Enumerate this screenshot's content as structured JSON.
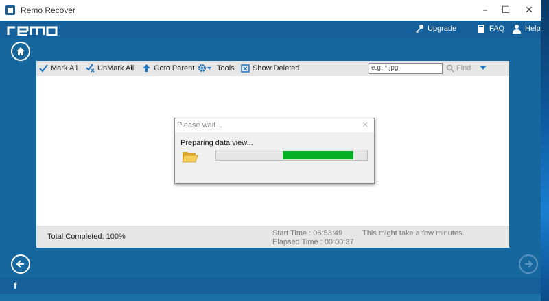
{
  "window": {
    "title": "Remo Recover"
  },
  "brand": {
    "logo_text": "remo"
  },
  "header": {
    "upgrade_label": "Upgrade",
    "faq_label": "FAQ",
    "help_label": "Help"
  },
  "toolbar": {
    "mark_all": "Mark All",
    "unmark_all": "UnMark All",
    "goto_parent": "Goto Parent",
    "tools": "Tools",
    "show_deleted": "Show Deleted",
    "search_placeholder": "e.g. *.jpg",
    "find": "Find"
  },
  "dialog": {
    "title": "Please wait...",
    "message": "Preparing data view...",
    "progress": {
      "start": 0.44,
      "end": 0.91
    }
  },
  "status": {
    "total_completed": "Total Completed: 100%",
    "start_time": "Start Time : 06:53:49",
    "elapsed_time": "Elapsed Time : 00:00:37",
    "note": "This might take a few minutes."
  },
  "footer": {
    "social": "f"
  },
  "colors": {
    "accent": "#17679f",
    "header": "#15609a",
    "progress": "#06b025",
    "toolbar_icon": "#1e74c0"
  },
  "icons": [
    "app-icon",
    "key-icon",
    "book-icon",
    "person-icon",
    "home-icon",
    "check-icon",
    "uncheck-icon",
    "arrow-up-icon",
    "gear-icon",
    "show-deleted-icon",
    "search-icon",
    "chevron-down-icon",
    "folder-icon",
    "back-icon",
    "next-icon",
    "facebook-icon"
  ]
}
